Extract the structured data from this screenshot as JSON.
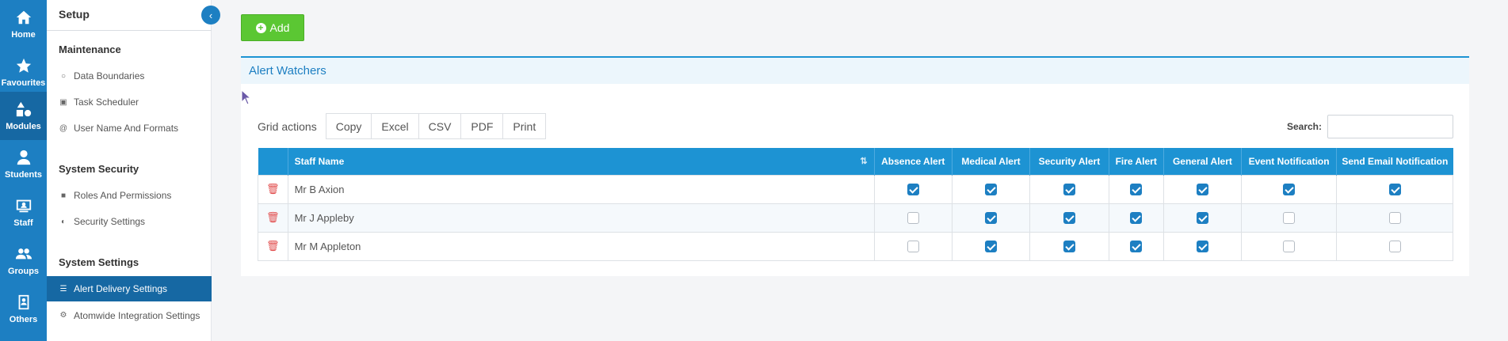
{
  "rail": [
    {
      "label": "Home",
      "icon": "home-icon"
    },
    {
      "label": "Favourites",
      "icon": "star-icon"
    },
    {
      "label": "Modules",
      "icon": "shapes-icon"
    },
    {
      "label": "Students",
      "icon": "person-icon"
    },
    {
      "label": "Staff",
      "icon": "id-card-icon"
    },
    {
      "label": "Groups",
      "icon": "group-icon"
    },
    {
      "label": "Others",
      "icon": "contact-book-icon"
    }
  ],
  "sidebar": {
    "title": "Setup",
    "sections": [
      {
        "title": "Maintenance",
        "items": [
          {
            "label": "Data Boundaries",
            "icon": "circle-icon"
          },
          {
            "label": "Task Scheduler",
            "icon": "calendar-icon"
          },
          {
            "label": "User Name And Formats",
            "icon": "at-icon"
          }
        ]
      },
      {
        "title": "System Security",
        "items": [
          {
            "label": "Roles And Permissions",
            "icon": "lock-icon"
          },
          {
            "label": "Security Settings",
            "icon": "shield-icon"
          }
        ]
      },
      {
        "title": "System Settings",
        "items": [
          {
            "label": "Alert Delivery Settings",
            "icon": "list-icon"
          },
          {
            "label": "Atomwide Integration Settings",
            "icon": "gear-icon"
          }
        ]
      }
    ]
  },
  "toolbar": {
    "add_label": "Add"
  },
  "panel": {
    "title": "Alert Watchers",
    "grid_actions_label": "Grid actions",
    "grid_actions": [
      "Copy",
      "Excel",
      "CSV",
      "PDF",
      "Print"
    ],
    "search_label": "Search:",
    "search_value": ""
  },
  "table": {
    "columns": [
      "Staff Name",
      "Absence Alert",
      "Medical Alert",
      "Security Alert",
      "Fire Alert",
      "General Alert",
      "Event Notification",
      "Send Email Notification"
    ],
    "rows": [
      {
        "name": "Mr B Axion",
        "flags": [
          true,
          true,
          true,
          true,
          true,
          true,
          true
        ]
      },
      {
        "name": "Mr J Appleby",
        "flags": [
          false,
          true,
          true,
          true,
          true,
          false,
          false
        ]
      },
      {
        "name": "Mr M Appleton",
        "flags": [
          false,
          true,
          true,
          true,
          true,
          false,
          false
        ]
      }
    ]
  },
  "colors": {
    "primary": "#1d7fc2",
    "header": "#1d93d3",
    "add_button": "#5bc733",
    "trash": "#e14b4b"
  }
}
